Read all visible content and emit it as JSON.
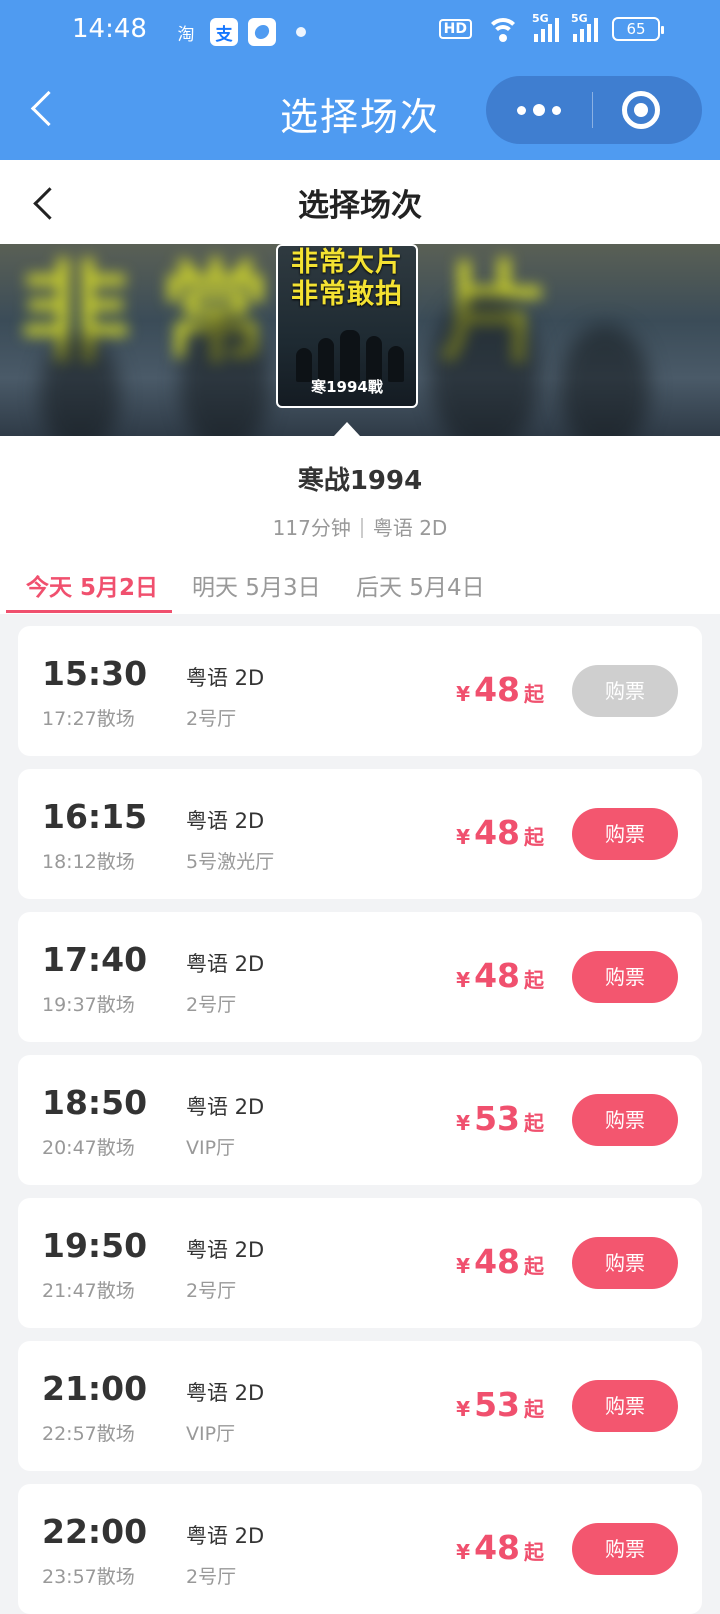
{
  "status_bar": {
    "time": "14:48",
    "apps": [
      "淘",
      "支"
    ],
    "hd": "HD",
    "signal1": "5G",
    "signal2": "5G",
    "battery": "65"
  },
  "mini_program": {
    "title": "选择场次"
  },
  "page": {
    "title": "选择场次"
  },
  "poster": {
    "line1": "非常大片",
    "line2": "非常敢拍",
    "logo": "寒1994戰"
  },
  "movie": {
    "title": "寒战1994",
    "duration": "117分钟",
    "format": "粤语 2D"
  },
  "tabs": [
    {
      "label": "今天 5月2日",
      "active": true
    },
    {
      "label": "明天 5月3日",
      "active": false
    },
    {
      "label": "后天 5月4日",
      "active": false
    }
  ],
  "sessions": [
    {
      "start": "15:30",
      "end": "17:27散场",
      "lang": "粤语 2D",
      "hall": "2号厅",
      "currency": "¥",
      "price": "48",
      "suffix": "起",
      "buy": "购票",
      "available": false
    },
    {
      "start": "16:15",
      "end": "18:12散场",
      "lang": "粤语 2D",
      "hall": "5号激光厅",
      "currency": "¥",
      "price": "48",
      "suffix": "起",
      "buy": "购票",
      "available": true
    },
    {
      "start": "17:40",
      "end": "19:37散场",
      "lang": "粤语 2D",
      "hall": "2号厅",
      "currency": "¥",
      "price": "48",
      "suffix": "起",
      "buy": "购票",
      "available": true
    },
    {
      "start": "18:50",
      "end": "20:47散场",
      "lang": "粤语 2D",
      "hall": "VIP厅",
      "currency": "¥",
      "price": "53",
      "suffix": "起",
      "buy": "购票",
      "available": true
    },
    {
      "start": "19:50",
      "end": "21:47散场",
      "lang": "粤语 2D",
      "hall": "2号厅",
      "currency": "¥",
      "price": "48",
      "suffix": "起",
      "buy": "购票",
      "available": true
    },
    {
      "start": "21:00",
      "end": "22:57散场",
      "lang": "粤语 2D",
      "hall": "VIP厅",
      "currency": "¥",
      "price": "53",
      "suffix": "起",
      "buy": "购票",
      "available": true
    },
    {
      "start": "22:00",
      "end": "23:57散场",
      "lang": "粤语 2D",
      "hall": "2号厅",
      "currency": "¥",
      "price": "48",
      "suffix": "起",
      "buy": "购票",
      "available": true
    }
  ],
  "colors": {
    "header_blue": "#4f9bf1",
    "accent_pink": "#f0506e",
    "disabled_gray": "#cfcfcf"
  }
}
